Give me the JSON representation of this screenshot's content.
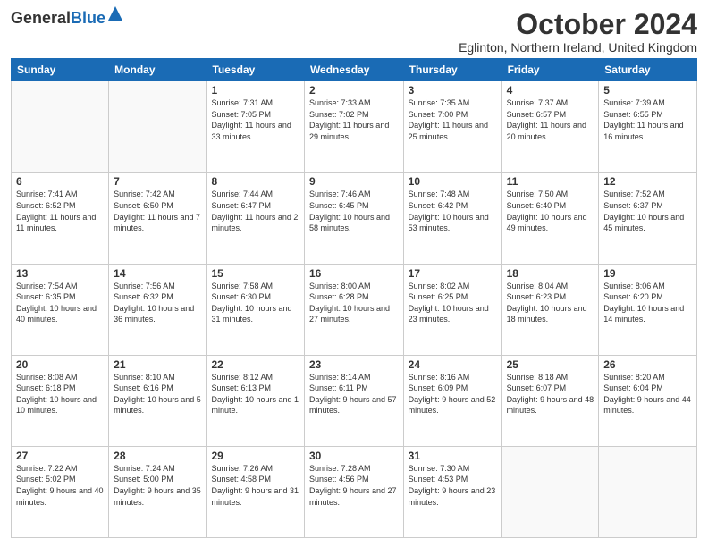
{
  "logo": {
    "general": "General",
    "blue": "Blue"
  },
  "header": {
    "month": "October 2024",
    "location": "Eglinton, Northern Ireland, United Kingdom"
  },
  "weekdays": [
    "Sunday",
    "Monday",
    "Tuesday",
    "Wednesday",
    "Thursday",
    "Friday",
    "Saturday"
  ],
  "weeks": [
    [
      {
        "day": "",
        "info": ""
      },
      {
        "day": "",
        "info": ""
      },
      {
        "day": "1",
        "info": "Sunrise: 7:31 AM\nSunset: 7:05 PM\nDaylight: 11 hours and 33 minutes."
      },
      {
        "day": "2",
        "info": "Sunrise: 7:33 AM\nSunset: 7:02 PM\nDaylight: 11 hours and 29 minutes."
      },
      {
        "day": "3",
        "info": "Sunrise: 7:35 AM\nSunset: 7:00 PM\nDaylight: 11 hours and 25 minutes."
      },
      {
        "day": "4",
        "info": "Sunrise: 7:37 AM\nSunset: 6:57 PM\nDaylight: 11 hours and 20 minutes."
      },
      {
        "day": "5",
        "info": "Sunrise: 7:39 AM\nSunset: 6:55 PM\nDaylight: 11 hours and 16 minutes."
      }
    ],
    [
      {
        "day": "6",
        "info": "Sunrise: 7:41 AM\nSunset: 6:52 PM\nDaylight: 11 hours and 11 minutes."
      },
      {
        "day": "7",
        "info": "Sunrise: 7:42 AM\nSunset: 6:50 PM\nDaylight: 11 hours and 7 minutes."
      },
      {
        "day": "8",
        "info": "Sunrise: 7:44 AM\nSunset: 6:47 PM\nDaylight: 11 hours and 2 minutes."
      },
      {
        "day": "9",
        "info": "Sunrise: 7:46 AM\nSunset: 6:45 PM\nDaylight: 10 hours and 58 minutes."
      },
      {
        "day": "10",
        "info": "Sunrise: 7:48 AM\nSunset: 6:42 PM\nDaylight: 10 hours and 53 minutes."
      },
      {
        "day": "11",
        "info": "Sunrise: 7:50 AM\nSunset: 6:40 PM\nDaylight: 10 hours and 49 minutes."
      },
      {
        "day": "12",
        "info": "Sunrise: 7:52 AM\nSunset: 6:37 PM\nDaylight: 10 hours and 45 minutes."
      }
    ],
    [
      {
        "day": "13",
        "info": "Sunrise: 7:54 AM\nSunset: 6:35 PM\nDaylight: 10 hours and 40 minutes."
      },
      {
        "day": "14",
        "info": "Sunrise: 7:56 AM\nSunset: 6:32 PM\nDaylight: 10 hours and 36 minutes."
      },
      {
        "day": "15",
        "info": "Sunrise: 7:58 AM\nSunset: 6:30 PM\nDaylight: 10 hours and 31 minutes."
      },
      {
        "day": "16",
        "info": "Sunrise: 8:00 AM\nSunset: 6:28 PM\nDaylight: 10 hours and 27 minutes."
      },
      {
        "day": "17",
        "info": "Sunrise: 8:02 AM\nSunset: 6:25 PM\nDaylight: 10 hours and 23 minutes."
      },
      {
        "day": "18",
        "info": "Sunrise: 8:04 AM\nSunset: 6:23 PM\nDaylight: 10 hours and 18 minutes."
      },
      {
        "day": "19",
        "info": "Sunrise: 8:06 AM\nSunset: 6:20 PM\nDaylight: 10 hours and 14 minutes."
      }
    ],
    [
      {
        "day": "20",
        "info": "Sunrise: 8:08 AM\nSunset: 6:18 PM\nDaylight: 10 hours and 10 minutes."
      },
      {
        "day": "21",
        "info": "Sunrise: 8:10 AM\nSunset: 6:16 PM\nDaylight: 10 hours and 5 minutes."
      },
      {
        "day": "22",
        "info": "Sunrise: 8:12 AM\nSunset: 6:13 PM\nDaylight: 10 hours and 1 minute."
      },
      {
        "day": "23",
        "info": "Sunrise: 8:14 AM\nSunset: 6:11 PM\nDaylight: 9 hours and 57 minutes."
      },
      {
        "day": "24",
        "info": "Sunrise: 8:16 AM\nSunset: 6:09 PM\nDaylight: 9 hours and 52 minutes."
      },
      {
        "day": "25",
        "info": "Sunrise: 8:18 AM\nSunset: 6:07 PM\nDaylight: 9 hours and 48 minutes."
      },
      {
        "day": "26",
        "info": "Sunrise: 8:20 AM\nSunset: 6:04 PM\nDaylight: 9 hours and 44 minutes."
      }
    ],
    [
      {
        "day": "27",
        "info": "Sunrise: 7:22 AM\nSunset: 5:02 PM\nDaylight: 9 hours and 40 minutes."
      },
      {
        "day": "28",
        "info": "Sunrise: 7:24 AM\nSunset: 5:00 PM\nDaylight: 9 hours and 35 minutes."
      },
      {
        "day": "29",
        "info": "Sunrise: 7:26 AM\nSunset: 4:58 PM\nDaylight: 9 hours and 31 minutes."
      },
      {
        "day": "30",
        "info": "Sunrise: 7:28 AM\nSunset: 4:56 PM\nDaylight: 9 hours and 27 minutes."
      },
      {
        "day": "31",
        "info": "Sunrise: 7:30 AM\nSunset: 4:53 PM\nDaylight: 9 hours and 23 minutes."
      },
      {
        "day": "",
        "info": ""
      },
      {
        "day": "",
        "info": ""
      }
    ]
  ]
}
